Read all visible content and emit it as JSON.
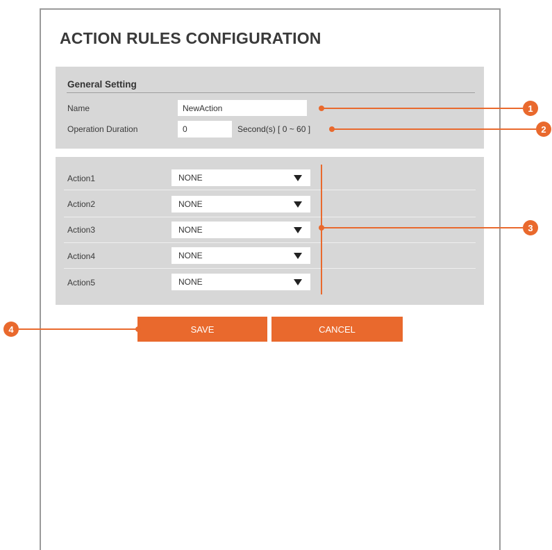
{
  "page": {
    "title": "ACTION RULES CONFIGURATION"
  },
  "general": {
    "section_title": "General Setting",
    "name_label": "Name",
    "name_value": "NewAction",
    "duration_label": "Operation Duration",
    "duration_value": "0",
    "duration_unit": "Second(s) [ 0 ~ 60 ]"
  },
  "actions": [
    {
      "label": "Action1",
      "value": "NONE"
    },
    {
      "label": "Action2",
      "value": "NONE"
    },
    {
      "label": "Action3",
      "value": "NONE"
    },
    {
      "label": "Action4",
      "value": "NONE"
    },
    {
      "label": "Action5",
      "value": "NONE"
    }
  ],
  "buttons": {
    "save": "SAVE",
    "cancel": "CANCEL"
  },
  "callouts": [
    "1",
    "2",
    "3",
    "4"
  ],
  "colors": {
    "accent": "#e9692d",
    "panel": "#d7d7d7",
    "border": "#9a9a9a"
  },
  "icons": {
    "dropdown": "triangle-down-icon"
  }
}
